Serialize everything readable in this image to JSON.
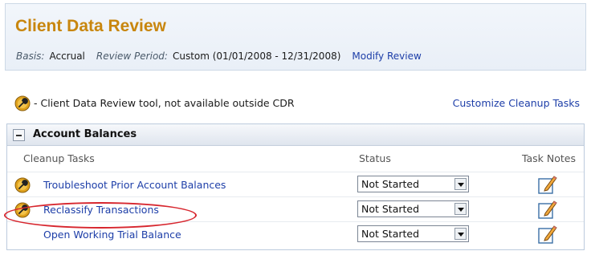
{
  "header": {
    "title": "Client Data Review",
    "basis_label": "Basis:",
    "basis_value": "Accrual",
    "period_label": "Review Period:",
    "period_value": "Custom (01/01/2008 - 12/31/2008)",
    "modify_link": "Modify Review"
  },
  "legend": {
    "icon": "cdr-wrench-icon",
    "text": "- Client Data Review tool, not available outside CDR",
    "customize_link": "Customize Cleanup Tasks"
  },
  "section": {
    "title": "Account Balances",
    "columns": {
      "tasks": "Cleanup Tasks",
      "status": "Status",
      "notes": "Task Notes"
    },
    "rows": [
      {
        "task": "Troubleshoot Prior Account Balances",
        "status": "Not Started",
        "has_cdr_icon": true
      },
      {
        "task": "Reclassify Transactions",
        "status": "Not Started",
        "has_cdr_icon": true,
        "highlighted": true
      },
      {
        "task": "Open Working Trial Balance",
        "status": "Not Started",
        "has_cdr_icon": false
      }
    ]
  },
  "colors": {
    "title": "#c8860e",
    "link": "#1d3ea8",
    "highlight": "#d7262e"
  }
}
